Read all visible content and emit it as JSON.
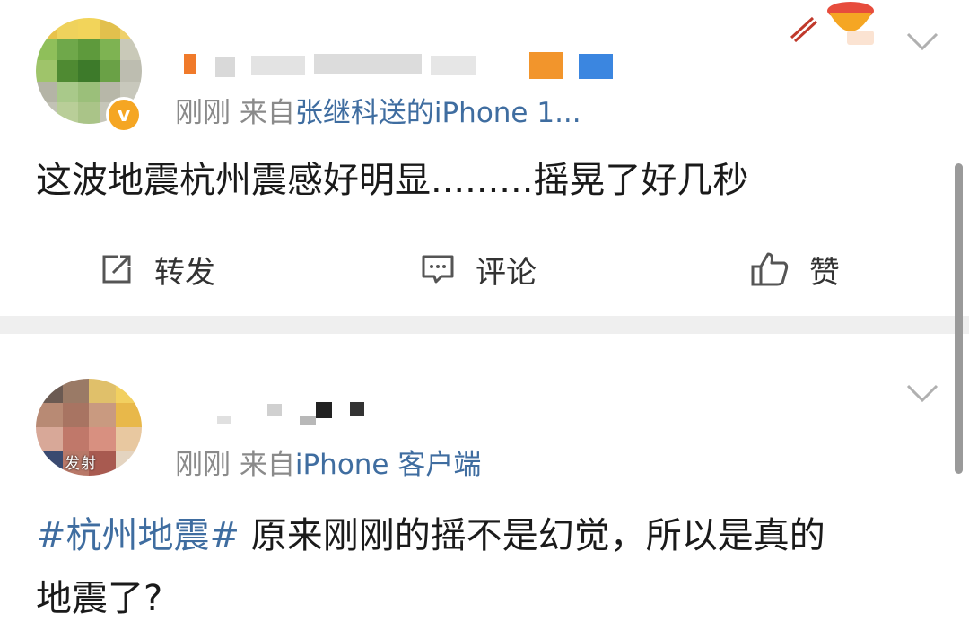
{
  "posts": [
    {
      "meta_time": "刚刚",
      "meta_from": "来自",
      "meta_source": "张继科送的iPhone 1...",
      "text": "这波地震杭州震感好明显.........摇晃了好几秒",
      "actions": {
        "repost": "转发",
        "comment": "评论",
        "like": "赞"
      }
    },
    {
      "meta_time": "刚刚",
      "meta_from": "来自",
      "meta_source": "iPhone 客户端",
      "avatar_badge": "发射",
      "hashtag": "#杭州地震#",
      "text_line1": " 原来刚刚的摇不是幻觉，所以是真的",
      "text_line2": "地震了?"
    }
  ],
  "colors": {
    "link": "#3f6da0",
    "meta": "#8a8a8a",
    "verified": "#f5a623"
  },
  "icons": [
    "repost-icon",
    "comment-icon",
    "like-icon",
    "chevron-down-icon",
    "verified-icon"
  ]
}
